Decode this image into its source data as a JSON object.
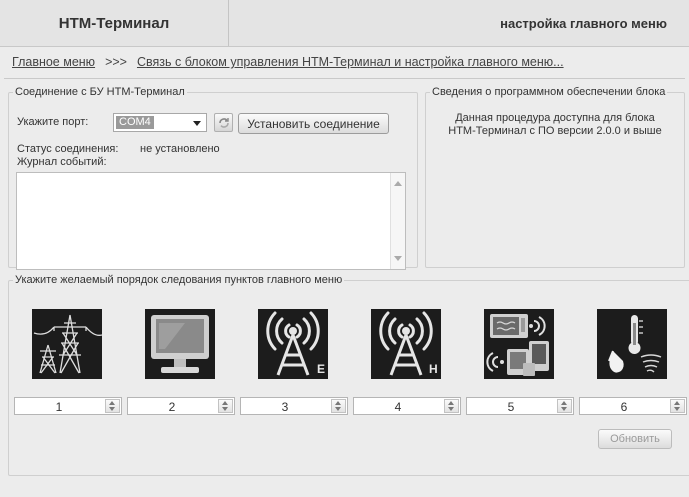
{
  "header": {
    "left_title": "НТМ-Терминал",
    "right_title": "настройка главного меню"
  },
  "breadcrumb": {
    "home": "Главное меню",
    "separator": ">>>",
    "current": "Связь с блоком управления НТМ-Терминал и настройка главного меню..."
  },
  "connection": {
    "legend": "Соединение с БУ НТМ-Терминал",
    "port_label": "Укажите порт:",
    "port_value": "COM4",
    "connect_button": "Установить соединение",
    "status_label": "Статус соединения:",
    "status_value": "не установлено",
    "log_label": "Журнал событий:",
    "log_text": ""
  },
  "software": {
    "legend": "Сведения о программном обеспечении блока",
    "info_line1": "Данная процедура доступна для блока",
    "info_line2": "НТМ-Терминал с ПО версии 2.0.0 и выше"
  },
  "menu_order": {
    "legend": "Укажите желаемый порядок следования пунктов главного меню",
    "items": [
      {
        "icon": "power-tower-icon",
        "order": "1"
      },
      {
        "icon": "monitor-icon",
        "order": "2"
      },
      {
        "icon": "antenna-e-icon",
        "letter": "E",
        "order": "3"
      },
      {
        "icon": "antenna-h-icon",
        "letter": "H",
        "order": "4"
      },
      {
        "icon": "microwave-devices-icon",
        "order": "5"
      },
      {
        "icon": "weather-icon",
        "order": "6"
      }
    ],
    "update_button": "Обновить"
  }
}
